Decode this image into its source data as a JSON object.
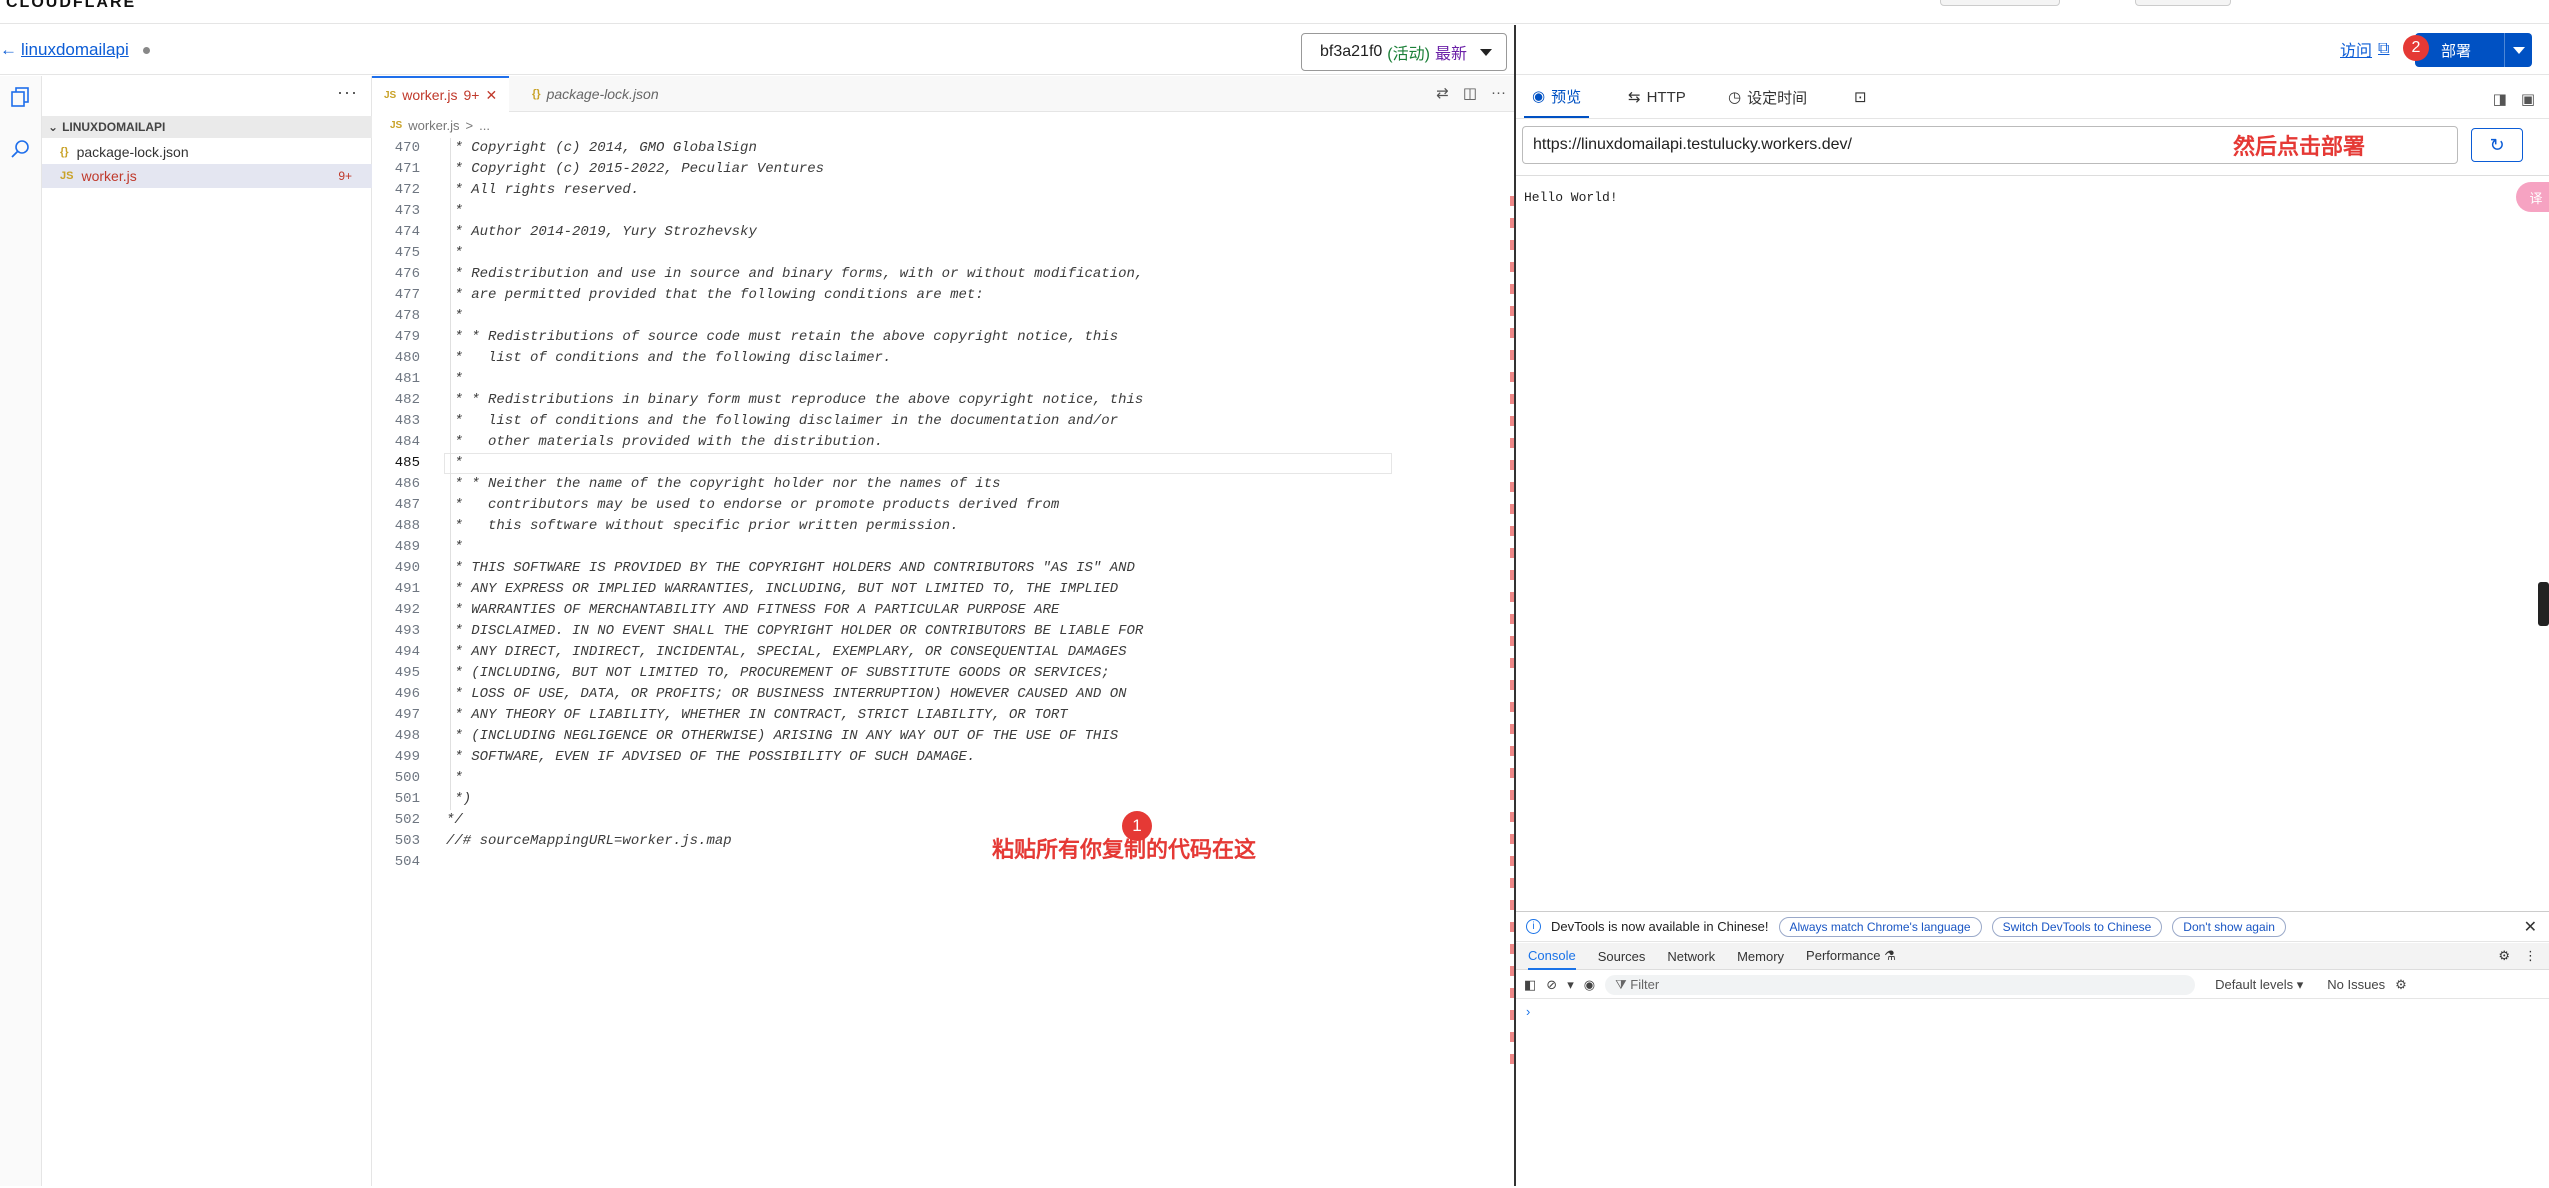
{
  "brand": {
    "logo": "CLOUDFLARE"
  },
  "header": {
    "back_link": "linuxdomailapi",
    "version": {
      "id": "bf3a21f0",
      "status": "(活动)",
      "tag": "最新"
    }
  },
  "explorer": {
    "folder": "LINUXDOMAILAPI",
    "files": [
      {
        "name": "package-lock.json",
        "icon": "{}"
      },
      {
        "name": "worker.js",
        "icon": "JS",
        "badge": "9+"
      }
    ]
  },
  "editor": {
    "tabs": [
      {
        "label": "worker.js",
        "badge": "9+",
        "icon": "JS"
      },
      {
        "label": "package-lock.json",
        "icon": "{}"
      }
    ],
    "breadcrumb": [
      "worker.js",
      ">",
      "..."
    ],
    "lines": [
      {
        "n": "470",
        "t": " * Copyright (c) 2014, GMO GlobalSign"
      },
      {
        "n": "471",
        "t": " * Copyright (c) 2015-2022, Peculiar Ventures"
      },
      {
        "n": "472",
        "t": " * All rights reserved."
      },
      {
        "n": "473",
        "t": " *"
      },
      {
        "n": "474",
        "t": " * Author 2014-2019, Yury Strozhevsky"
      },
      {
        "n": "475",
        "t": " *"
      },
      {
        "n": "476",
        "t": " * Redistribution and use in source and binary forms, with or without modification,"
      },
      {
        "n": "477",
        "t": " * are permitted provided that the following conditions are met:"
      },
      {
        "n": "478",
        "t": " *"
      },
      {
        "n": "479",
        "t": " * * Redistributions of source code must retain the above copyright notice, this"
      },
      {
        "n": "480",
        "t": " *   list of conditions and the following disclaimer."
      },
      {
        "n": "481",
        "t": " *"
      },
      {
        "n": "482",
        "t": " * * Redistributions in binary form must reproduce the above copyright notice, this"
      },
      {
        "n": "483",
        "t": " *   list of conditions and the following disclaimer in the documentation and/or"
      },
      {
        "n": "484",
        "t": " *   other materials provided with the distribution."
      },
      {
        "n": "485",
        "t": " *"
      },
      {
        "n": "486",
        "t": " * * Neither the name of the copyright holder nor the names of its"
      },
      {
        "n": "487",
        "t": " *   contributors may be used to endorse or promote products derived from"
      },
      {
        "n": "488",
        "t": " *   this software without specific prior written permission."
      },
      {
        "n": "489",
        "t": " *"
      },
      {
        "n": "490",
        "t": " * THIS SOFTWARE IS PROVIDED BY THE COPYRIGHT HOLDERS AND CONTRIBUTORS \"AS IS\" AND"
      },
      {
        "n": "491",
        "t": " * ANY EXPRESS OR IMPLIED WARRANTIES, INCLUDING, BUT NOT LIMITED TO, THE IMPLIED"
      },
      {
        "n": "492",
        "t": " * WARRANTIES OF MERCHANTABILITY AND FITNESS FOR A PARTICULAR PURPOSE ARE"
      },
      {
        "n": "493",
        "t": " * DISCLAIMED. IN NO EVENT SHALL THE COPYRIGHT HOLDER OR CONTRIBUTORS BE LIABLE FOR"
      },
      {
        "n": "494",
        "t": " * ANY DIRECT, INDIRECT, INCIDENTAL, SPECIAL, EXEMPLARY, OR CONSEQUENTIAL DAMAGES"
      },
      {
        "n": "495",
        "t": " * (INCLUDING, BUT NOT LIMITED TO, PROCUREMENT OF SUBSTITUTE GOODS OR SERVICES;"
      },
      {
        "n": "496",
        "t": " * LOSS OF USE, DATA, OR PROFITS; OR BUSINESS INTERRUPTION) HOWEVER CAUSED AND ON"
      },
      {
        "n": "497",
        "t": " * ANY THEORY OF LIABILITY, WHETHER IN CONTRACT, STRICT LIABILITY, OR TORT"
      },
      {
        "n": "498",
        "t": " * (INCLUDING NEGLIGENCE OR OTHERWISE) ARISING IN ANY WAY OUT OF THE USE OF THIS"
      },
      {
        "n": "499",
        "t": " * SOFTWARE, EVEN IF ADVISED OF THE POSSIBILITY OF SUCH DAMAGE."
      },
      {
        "n": "500",
        "t": " *"
      },
      {
        "n": "501",
        "t": " *)"
      },
      {
        "n": "502",
        "t": "*/"
      },
      {
        "n": "503",
        "t": "//# sourceMappingURL=worker.js.map"
      },
      {
        "n": "504",
        "t": ""
      }
    ],
    "current_line": "485"
  },
  "annotations": {
    "step1": "1",
    "step2": "2",
    "paste_hint": "粘贴所有你复制的代码在这",
    "deploy_hint": "然后点击部署"
  },
  "right": {
    "visit": "访问",
    "deploy": "部署",
    "tabs": [
      "预览",
      "HTTP",
      "设定时间",
      ""
    ],
    "url": "https://linuxdomailapi.testulucky.workers.dev/",
    "preview_text": "Hello World!",
    "translate_fab": "译"
  },
  "devtools": {
    "banner": "DevTools is now available in Chinese!",
    "buttons": [
      "Always match Chrome's language",
      "Switch DevTools to Chinese",
      "Don't show again"
    ],
    "tabs": [
      "Console",
      "Sources",
      "Network",
      "Memory",
      "Performance"
    ],
    "filter_placeholder": "Filter",
    "levels": "Default levels ▾",
    "issues": "No Issues",
    "prompt": "›"
  },
  "colors": {
    "accent": "#0051c3",
    "annotation_red": "#e53935"
  }
}
